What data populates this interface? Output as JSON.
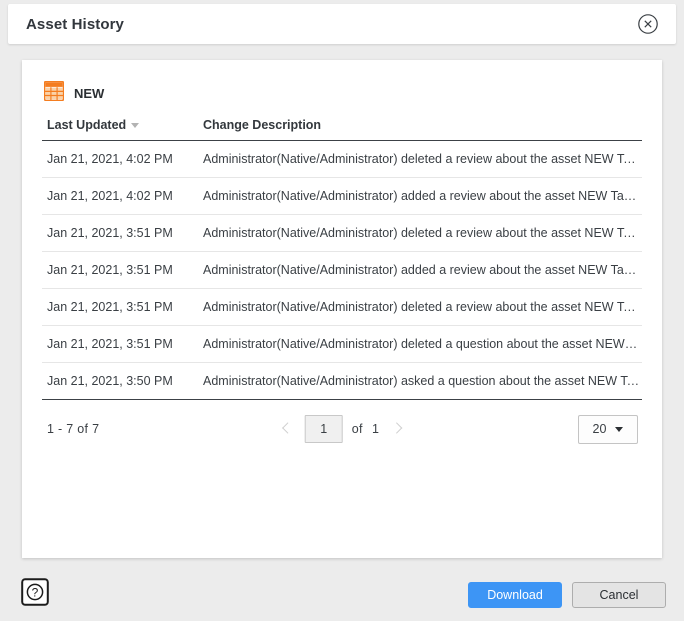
{
  "dialog": {
    "title": "Asset History",
    "close_icon": "close-circle-icon"
  },
  "asset": {
    "icon": "table-grid-icon",
    "icon_color": "#f47d20",
    "name": "NEW"
  },
  "table": {
    "columns": [
      {
        "key": "last_updated",
        "label": "Last Updated",
        "sorted": true,
        "sort_icon": "sort-descending-caret"
      },
      {
        "key": "change_description",
        "label": "Change Description",
        "sorted": false
      }
    ],
    "rows": [
      {
        "last_updated": "Jan 21, 2021, 4:02 PM",
        "change_description": "Administrator(Native/Administrator) deleted a review about the asset NEW Table."
      },
      {
        "last_updated": "Jan 21, 2021, 4:02 PM",
        "change_description": "Administrator(Native/Administrator) added a review about the asset NEW Table."
      },
      {
        "last_updated": "Jan 21, 2021, 3:51 PM",
        "change_description": "Administrator(Native/Administrator) deleted a review about the asset NEW Table."
      },
      {
        "last_updated": "Jan 21, 2021, 3:51 PM",
        "change_description": "Administrator(Native/Administrator) added a review about the asset NEW Table."
      },
      {
        "last_updated": "Jan 21, 2021, 3:51 PM",
        "change_description": "Administrator(Native/Administrator) deleted a review about the asset NEW Table."
      },
      {
        "last_updated": "Jan 21, 2021, 3:51 PM",
        "change_description": "Administrator(Native/Administrator) deleted a question about the asset NEW Tab..."
      },
      {
        "last_updated": "Jan 21, 2021, 3:50 PM",
        "change_description": "Administrator(Native/Administrator) asked a question about the asset NEW Table."
      }
    ]
  },
  "pagination": {
    "range_text": "1 - 7  of  7",
    "prev_icon": "chevron-left-icon",
    "next_icon": "chevron-right-icon",
    "current_page": "1",
    "of_text": "of",
    "total_pages": "1",
    "page_size": "20",
    "page_size_caret": "chevron-down-icon"
  },
  "footer": {
    "help_icon": "help-question-icon",
    "download_label": "Download",
    "cancel_label": "Cancel",
    "primary_color": "#3d95f5"
  }
}
